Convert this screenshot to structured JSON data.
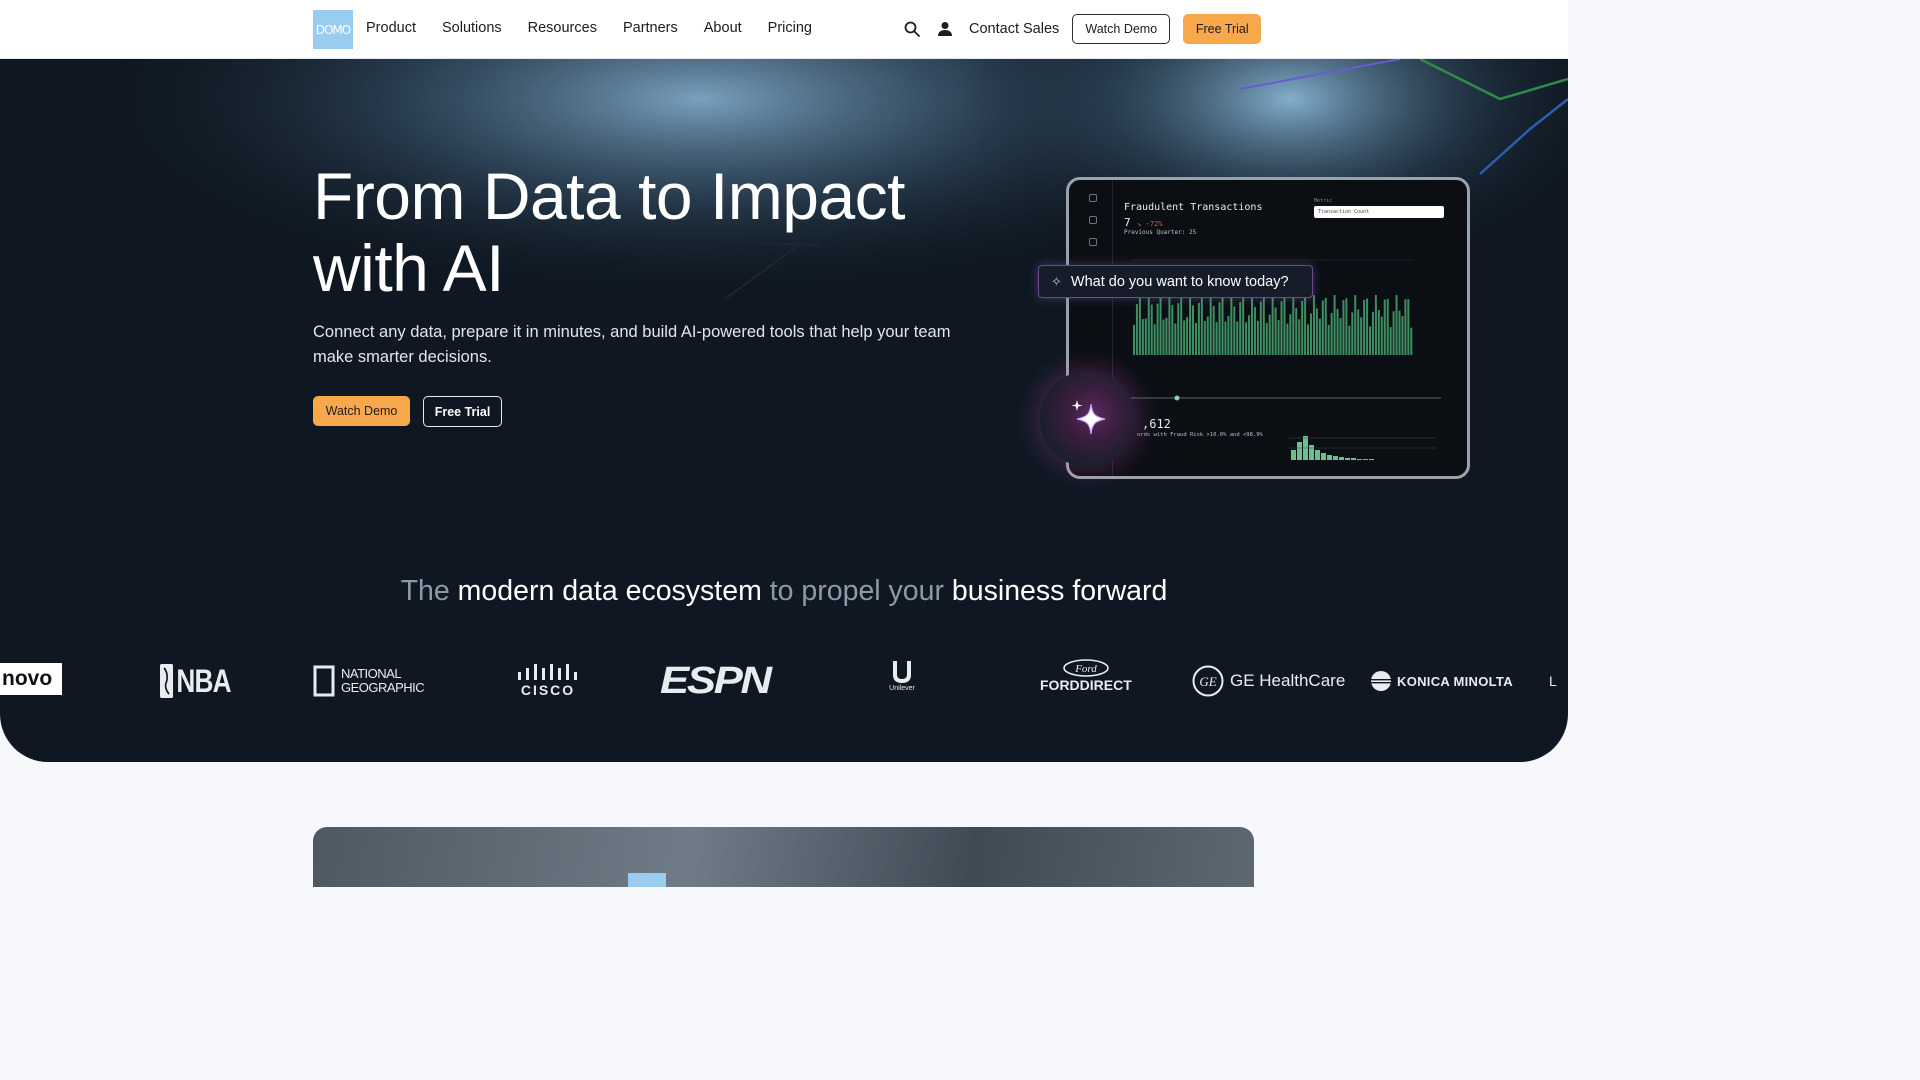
{
  "nav": {
    "logo_text": "DOMO",
    "links": [
      "Product",
      "Solutions",
      "Resources",
      "Partners",
      "About",
      "Pricing"
    ],
    "contact": "Contact Sales",
    "watch_demo": "Watch Demo",
    "free_trial": "Free Trial"
  },
  "hero": {
    "title": "From Data to Impact with AI",
    "subtitle": "Connect any data, prepare it in minutes, and build AI-powered tools that help your team make smarter decisions.",
    "watch_demo": "Watch Demo",
    "free_trial": "Free Trial",
    "ask_prompt": "What do you want to know today?"
  },
  "dashboard": {
    "title": "Fraudulent Transactions",
    "value": "7",
    "change": "↘ -72%",
    "previous": "Previous Quarter: 25",
    "metric_label": "Metric",
    "metric_value": "Transaction Count",
    "records_value": ",612",
    "records_note": "ords with Fraud Risk >10.0% and <98.9%"
  },
  "ecosystem": {
    "part1": "The ",
    "part2": "modern data ecosystem",
    "part3": " to propel your ",
    "part4": "business forward"
  },
  "customer_logos": [
    "novo",
    "NBA",
    "NATIONAL GEOGRAPHIC",
    "CISCO",
    "ESPN",
    "Unilever",
    "FORDDIRECT",
    "GE HealthCare",
    "KONICA MINOLTA",
    "L"
  ],
  "colors": {
    "accent_orange": "#f7a84a",
    "hero_bg": "#0f1822",
    "logo_blue": "#99ccee"
  }
}
